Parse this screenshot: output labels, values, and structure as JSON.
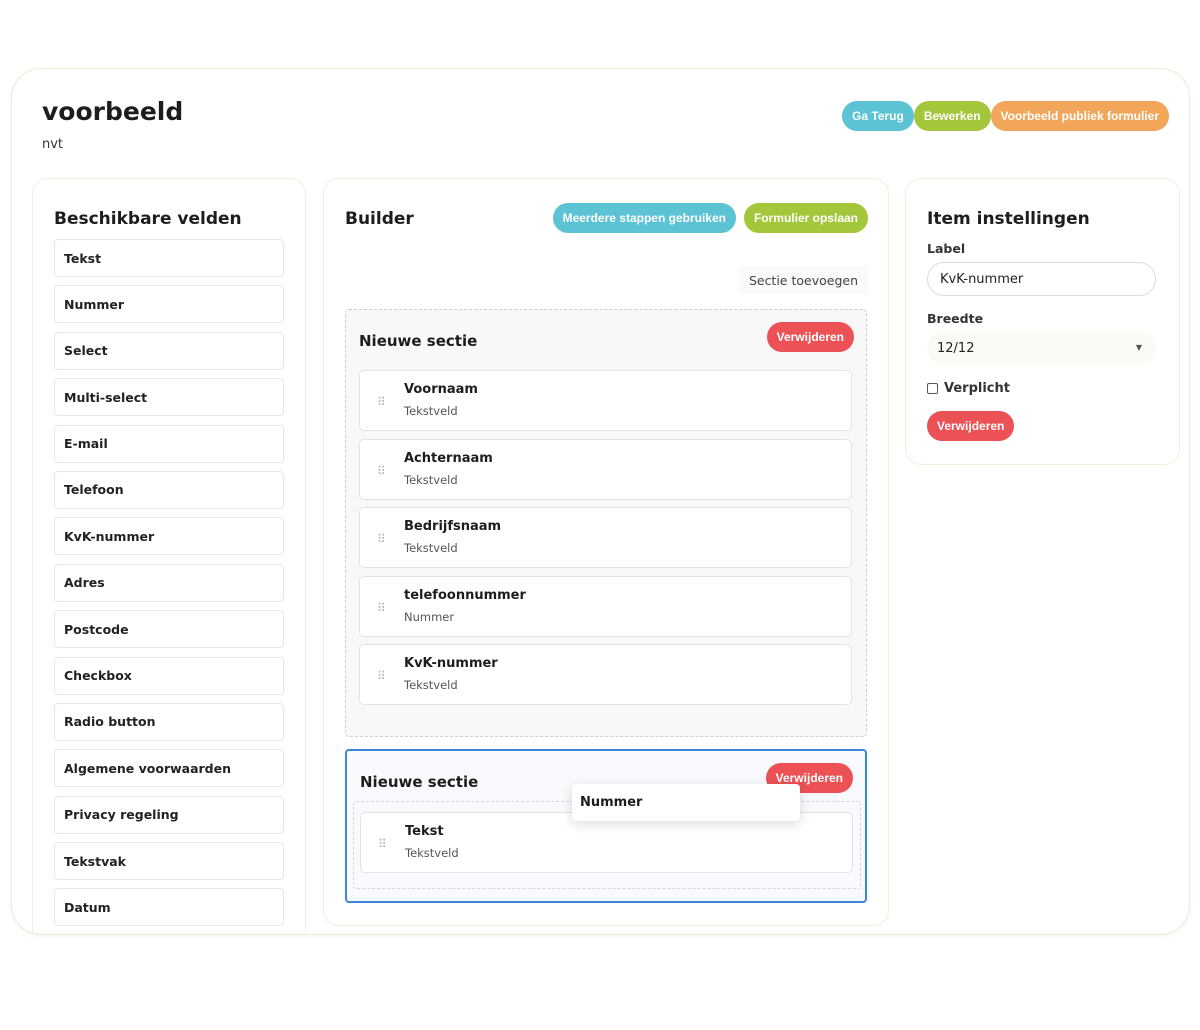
{
  "header": {
    "title": "voorbeeld",
    "subtitle": "nvt"
  },
  "actions": {
    "back": "Ga Terug",
    "edit": "Bewerken",
    "preview": "Voorbeeld publiek formulier"
  },
  "available_fields": {
    "title": "Beschikbare velden",
    "items": [
      "Tekst",
      "Nummer",
      "Select",
      "Multi-select",
      "E-mail",
      "Telefoon",
      "KvK-nummer",
      "Adres",
      "Postcode",
      "Checkbox",
      "Radio button",
      "Algemene voorwaarden",
      "Privacy regeling",
      "Tekstvak",
      "Datum"
    ]
  },
  "builder": {
    "title": "Builder",
    "multi_step": "Meerdere stappen gebruiken",
    "save": "Formulier opslaan",
    "add_section": "Sectie toevoegen",
    "sections": [
      {
        "title": "Nieuwe sectie",
        "delete": "Verwijderen",
        "rows": [
          {
            "label": "Voornaam",
            "type": "Tekstveld"
          },
          {
            "label": "Achternaam",
            "type": "Tekstveld"
          },
          {
            "label": "Bedrijfsnaam",
            "type": "Tekstveld"
          },
          {
            "label": "telefoonnummer",
            "type": "Nummer"
          },
          {
            "label": "KvK-nummer",
            "type": "Tekstveld"
          }
        ]
      },
      {
        "title": "Nieuwe sectie",
        "delete": "Verwijderen",
        "rows": [
          {
            "label": "Tekst",
            "type": "Tekstveld"
          }
        ],
        "dragging": "Nummer"
      }
    ]
  },
  "item_settings": {
    "title": "Item instellingen",
    "label_label": "Label",
    "label_value": "KvK-nummer",
    "width_label": "Breedte",
    "width_value": "12/12",
    "required_label": "Verplicht",
    "required_checked": false,
    "delete": "Verwijderen"
  },
  "colors": {
    "cyan": "#5cc3d4",
    "green": "#a4c63a",
    "orange": "#f2a65a",
    "red": "#eb5155",
    "selected_border": "#3d86de"
  }
}
